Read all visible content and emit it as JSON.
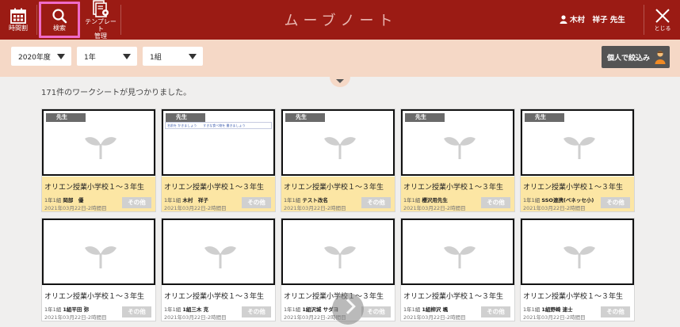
{
  "header": {
    "app_title": "ムーブノート",
    "user_name": "木村　祥子 先生",
    "nav": {
      "timetable_label": "時間割",
      "search_label": "検索",
      "template_label": "テンプレート\n管理"
    },
    "close_label": "とじる"
  },
  "filters": {
    "year": "2020年度",
    "grade": "1年",
    "class": "1組",
    "personal_button": "個人で絞込み"
  },
  "results": {
    "count_text": "171件のワークシートが見つかりました。"
  },
  "cards": [
    {
      "tag": "先生",
      "title": "オリエン授業小学校１～３年生",
      "class": "1年1組",
      "author": "岡部　優",
      "date": "2021年03月22日-2時間目",
      "other": "その他",
      "style": "yellow",
      "preview": "sprout"
    },
    {
      "tag": "先生",
      "title": "オリエン授業小学校１～３年生",
      "class": "1年1組",
      "author": "木村　祥子",
      "date": "2021年03月22日-2時間目",
      "other": "その他",
      "style": "yellow",
      "preview": "worksheet",
      "preview_text": "名前を かきましょう　　すきな食べ物を 書きましょう"
    },
    {
      "tag": "先生",
      "title": "オリエン授業小学校１～３年生",
      "class": "1年1組",
      "author": "テスト改名",
      "date": "2021年03月22日-2時間目",
      "other": "その他",
      "style": "yellow",
      "preview": "sprout"
    },
    {
      "tag": "先生",
      "title": "オリエン授業小学校１～３年生",
      "class": "1年1組",
      "author": "櫻沢用先生",
      "date": "2021年03月22日-2時間目",
      "other": "その他",
      "style": "yellow",
      "preview": "sprout"
    },
    {
      "tag": "先生",
      "title": "オリエン授業小学校１～３年生",
      "class": "1年1組",
      "author": "SSO連携(ベネッセ小)",
      "date": "2021年03月22日-2時間目",
      "other": "その他",
      "style": "yellow",
      "preview": "sprout"
    },
    {
      "tag": "",
      "title": "オリエン授業小学校１～３年生",
      "class": "1年1組",
      "author": "1組平田 弥",
      "date": "2021年03月22日-2時間目",
      "other": "その他",
      "style": "white",
      "preview": "sprout"
    },
    {
      "tag": "",
      "title": "オリエン授業小学校１～３年生",
      "class": "1年1組",
      "author": "1組三木 克",
      "date": "2021年03月22日-2時間目",
      "other": "その他",
      "style": "white",
      "preview": "sprout"
    },
    {
      "tag": "",
      "title": "オリエン授業小学校１～３年生",
      "class": "1年1組",
      "author": "1組沢城 サダヨ",
      "date": "2021年03月22日-2時間目",
      "other": "その他",
      "style": "white",
      "preview": "sprout"
    },
    {
      "tag": "",
      "title": "オリエン授業小学校１～３年生",
      "class": "1年1組",
      "author": "1組柳沢 颯",
      "date": "2021年03月22日-2時間目",
      "other": "その他",
      "style": "white",
      "preview": "sprout"
    },
    {
      "tag": "",
      "title": "オリエン授業小学校１～３年生",
      "class": "1年1組",
      "author": "1組野崎 速士",
      "date": "2021年03月22日-2時間目",
      "other": "その他",
      "style": "white",
      "preview": "sprout"
    }
  ],
  "colors": {
    "header_bg": "#9b1b14",
    "filter_bg": "#f5d8c6",
    "card_highlight": "#fce6a4",
    "search_highlight": "#f06ac7"
  }
}
